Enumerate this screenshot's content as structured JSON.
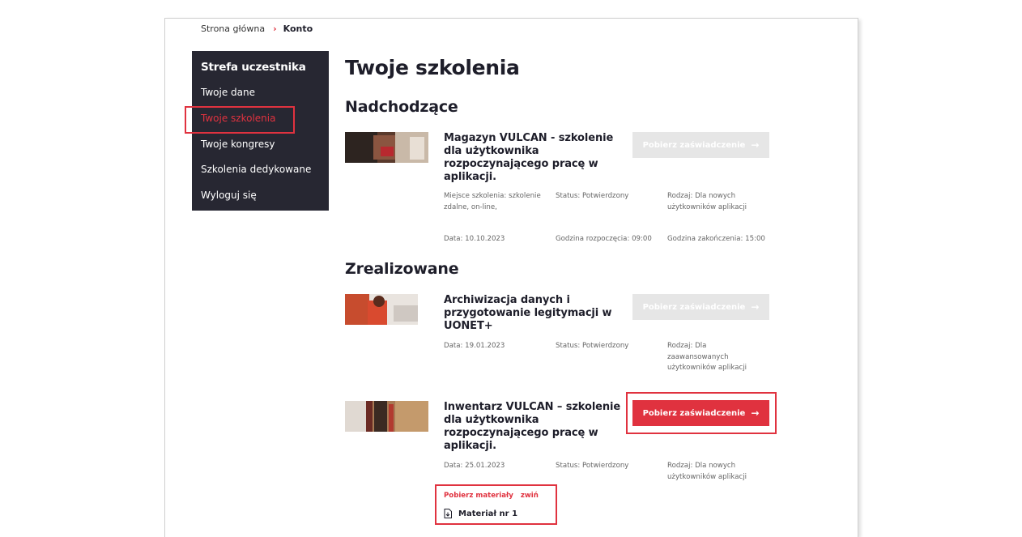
{
  "breadcrumb": {
    "home": "Strona główna",
    "separator": "›",
    "current": "Konto"
  },
  "sidebar": {
    "title": "Strefa uczestnika",
    "items": [
      {
        "label": "Twoje dane"
      },
      {
        "label": "Twoje szkolenia",
        "active": true
      },
      {
        "label": "Twoje kongresy"
      },
      {
        "label": "Szkolenia dedykowane"
      },
      {
        "label": "Wyloguj się"
      }
    ]
  },
  "main": {
    "title": "Twoje szkolenia",
    "upcoming_title": "Nadchodzące",
    "completed_title": "Zrealizowane",
    "courses": [
      {
        "title": "Magazyn VULCAN - szkolenie dla użytkownika rozpoczynającego pracę w aplikacji.",
        "button": "Pobierz zaświadczenie",
        "button_enabled": false,
        "place": "Miejsce szkolenia: szkolenie zdalne, on-line,",
        "status": "Status: Potwierdzony",
        "kind": "Rodzaj: Dla nowych użytkowników aplikacji",
        "date": "Data: 10.10.2023",
        "start": "Godzina rozpoczęcia: 09:00",
        "end": "Godzina zakończenia: 15:00"
      },
      {
        "title": "Archiwizacja danych i przygotowanie legitymacji w UONET+",
        "button": "Pobierz zaświadczenie",
        "button_enabled": false,
        "date": "Data: 19.01.2023",
        "status": "Status: Potwierdzony",
        "kind": "Rodzaj: Dla zaawansowanych użytkowników aplikacji"
      },
      {
        "title": "Inwentarz VULCAN – szkolenie dla użytkownika rozpoczynającego pracę w aplikacji.",
        "button": "Pobierz zaświadczenie",
        "button_enabled": true,
        "date": "Data: 25.01.2023",
        "status": "Status: Potwierdzony",
        "kind": "Rodzaj: Dla nowych użytkowników aplikacji",
        "materials_label": "Pobierz materiały",
        "collapse_label": "zwiń",
        "materials": [
          {
            "name": "Materiał nr 1"
          }
        ]
      }
    ]
  },
  "colors": {
    "accent": "#e0323f",
    "sidebar_bg": "#272732",
    "disabled_button": "#e6e6e6",
    "text": "#1e1e2a"
  },
  "icons": {
    "arrow": "arrow-right-icon",
    "download": "download-file-icon"
  }
}
